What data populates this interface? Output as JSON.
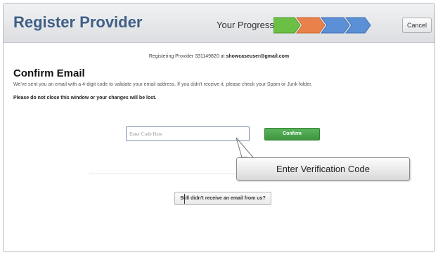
{
  "header": {
    "title": "Register Provider",
    "progress_label": "Your Progress",
    "progress_step_colors": [
      "#6cbf45",
      "#e9824a",
      "#5b8fd6",
      "#5b8fd6"
    ],
    "cancel_label": "Cancel"
  },
  "registering": {
    "prefix": "Registering Provider 331149820 at",
    "email": "showcaseuser@gmail.com"
  },
  "confirm": {
    "title": "Confirm Email",
    "description": "We've sent you an email with a 4-digit code to validate your email address. If you didn't receive it, please check your Spam or Junk folder.",
    "warning": "Please do not close this window or your changes will be lost.",
    "code_placeholder": "Enter Code Here",
    "confirm_label": "Confirm",
    "resend_label": "Still didn't receive an email from us?"
  },
  "callout": {
    "text": "Enter Verification Code"
  },
  "colors": {
    "title": "#3f5f86",
    "confirm_button": "#4aa64c"
  }
}
